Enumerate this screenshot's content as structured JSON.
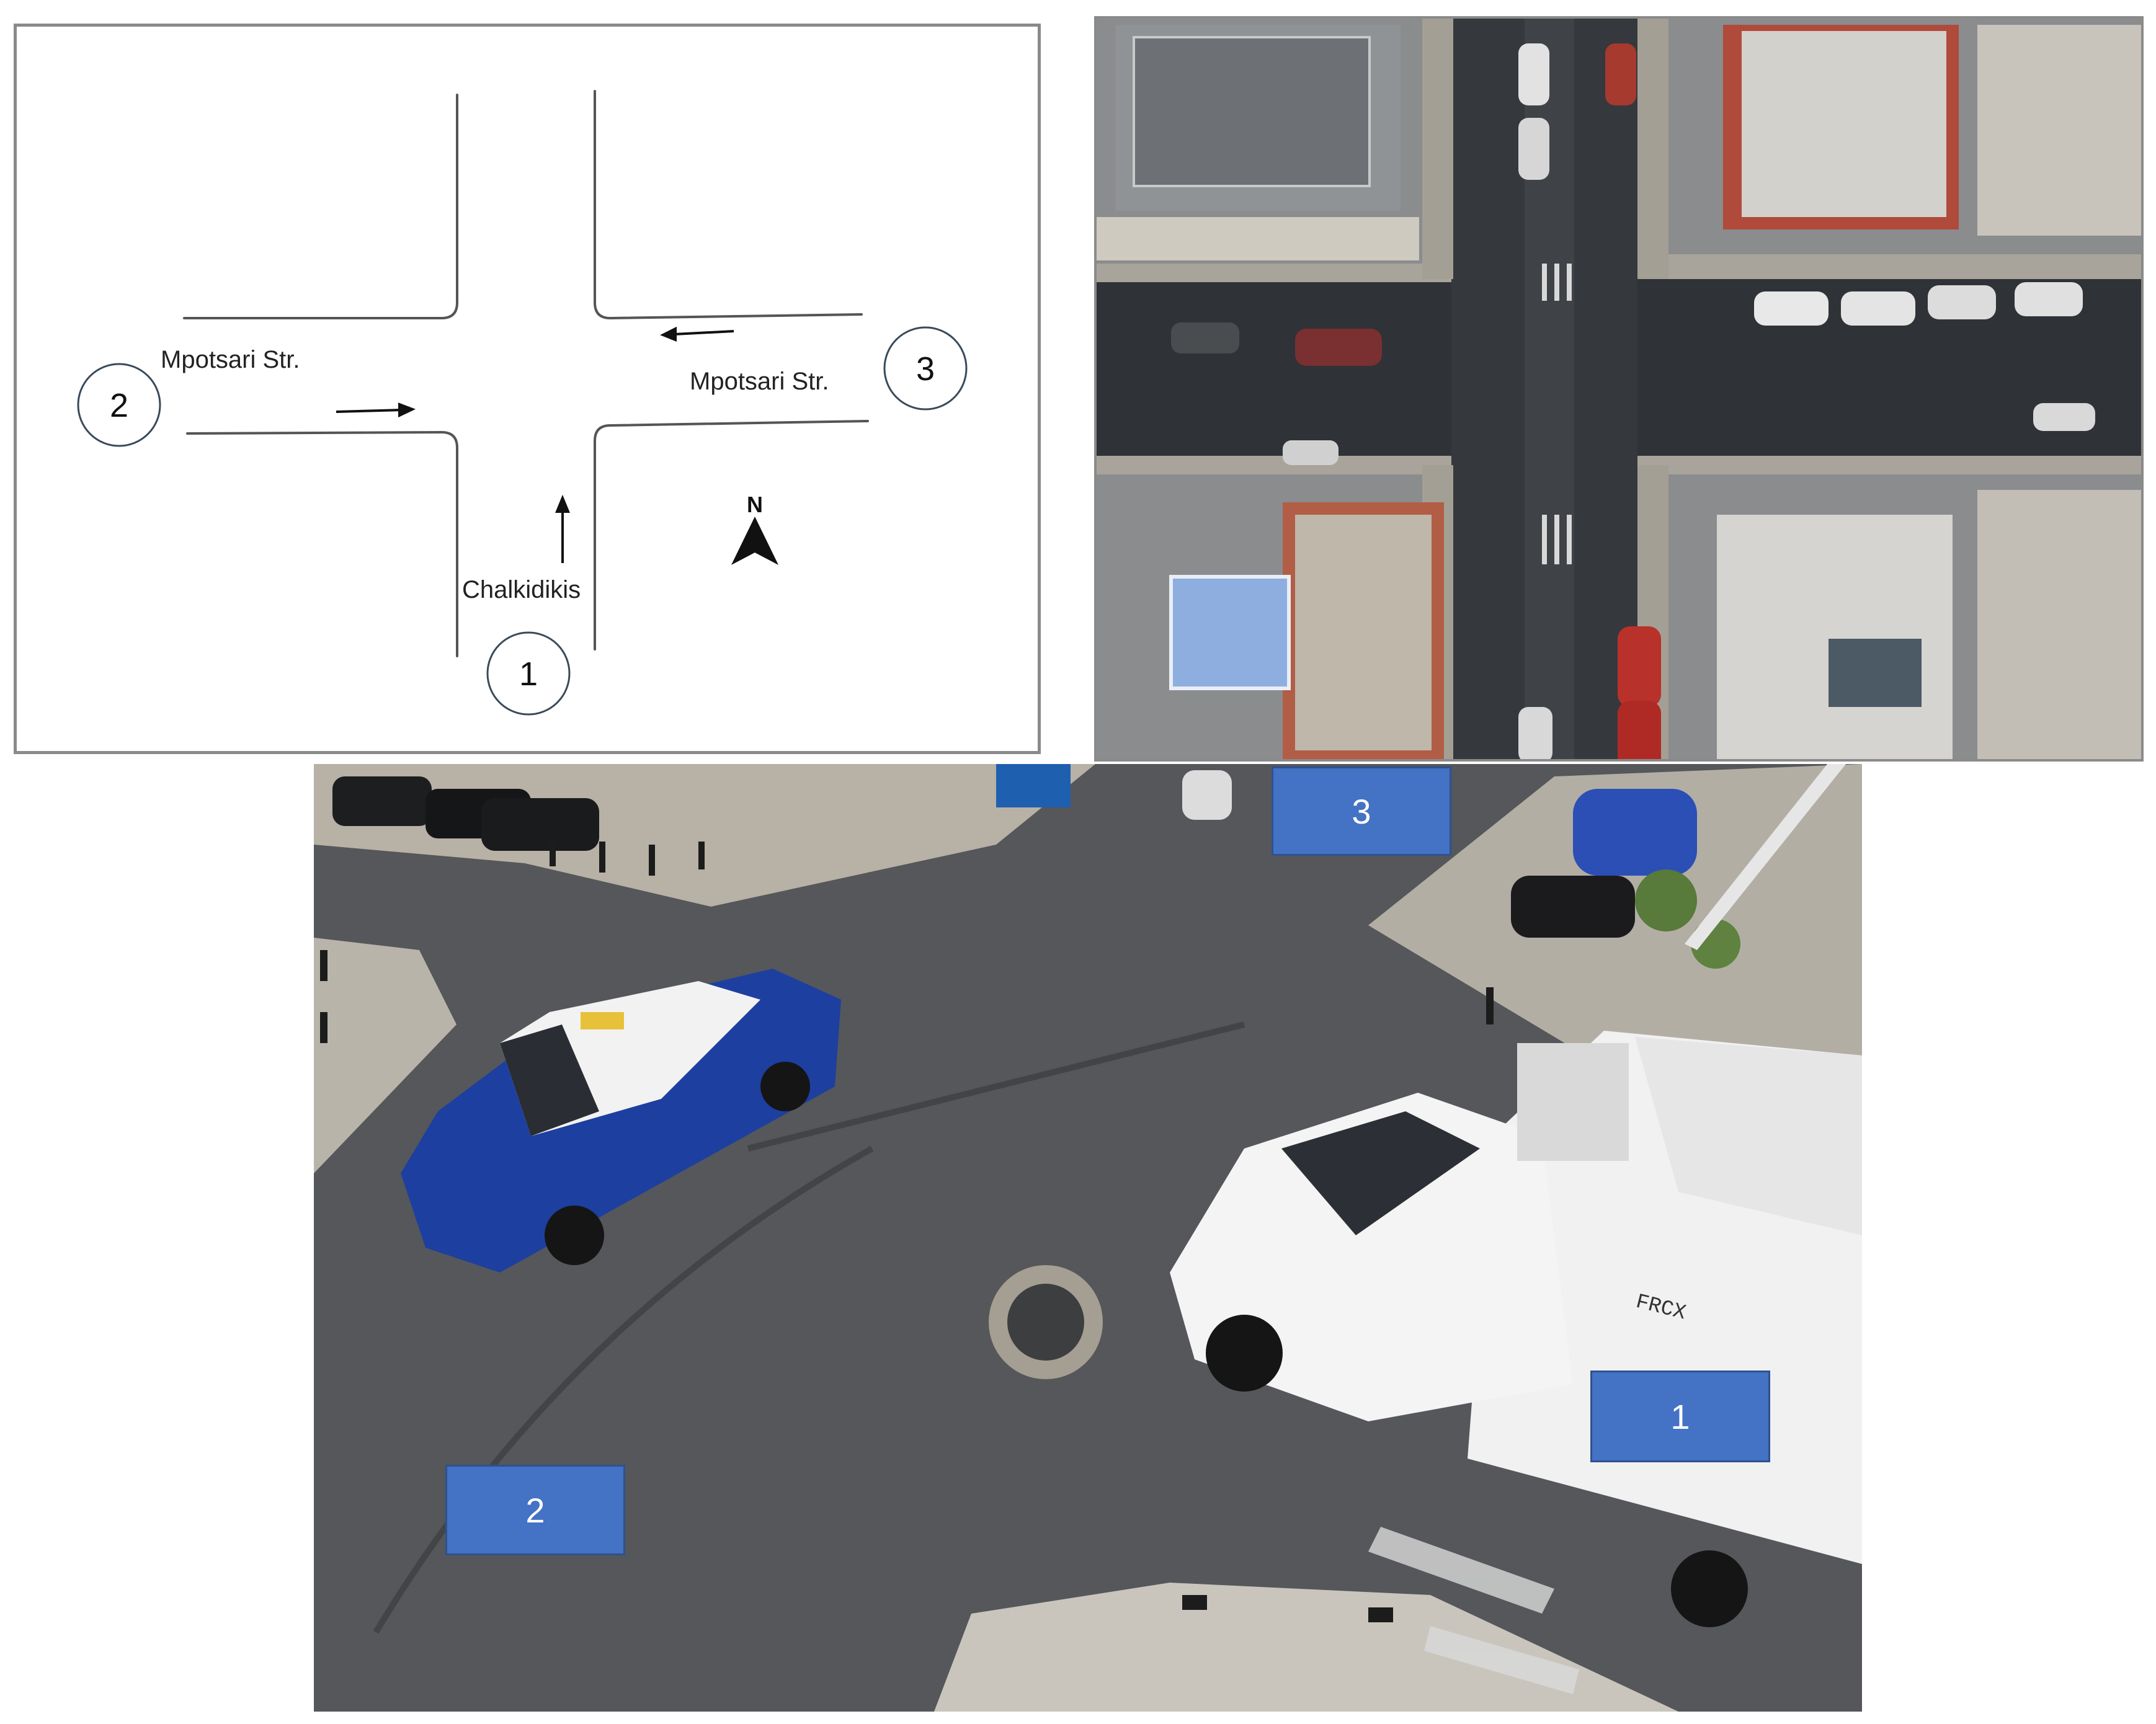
{
  "schematic": {
    "street_west": "Mpotsari Str.",
    "street_east": "Mpotsari Str.",
    "street_south": "Chalkidikis",
    "approach_1": "1",
    "approach_2": "2",
    "approach_3": "3",
    "north": "N"
  },
  "photo": {
    "label_1": "1",
    "label_2": "2",
    "label_3": "3",
    "truck_plate": "FRCX",
    "label_color": "#4472c4"
  }
}
